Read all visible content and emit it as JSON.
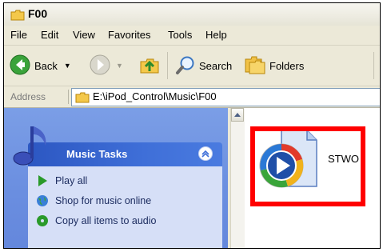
{
  "window": {
    "title": "F00"
  },
  "menu": [
    "File",
    "Edit",
    "View",
    "Favorites",
    "Tools",
    "Help"
  ],
  "toolbar": {
    "back": "Back",
    "search": "Search",
    "folders": "Folders"
  },
  "address": {
    "label": "Address",
    "path": "E:\\iPod_Control\\Music\\F00"
  },
  "sidebar": {
    "panel_title": "Music Tasks",
    "tasks": [
      "Play all",
      "Shop for music online",
      "Copy all items to audio"
    ]
  },
  "files": [
    {
      "name": "STWO",
      "icon": "windows-media-icon"
    }
  ],
  "colors": {
    "highlight": "#ff0000",
    "panel_header": "#3f6fd8",
    "pane_bg": "#6a8ee0"
  }
}
